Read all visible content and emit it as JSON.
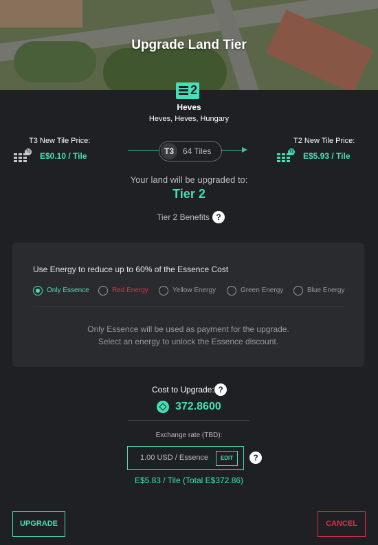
{
  "header": {
    "title": "Upgrade Land Tier"
  },
  "location": {
    "tier_badge": "2",
    "name": "Heves",
    "address": "Heves, Heves, Hungary"
  },
  "pricing": {
    "current": {
      "label": "T3 New Tile Price:",
      "value": "E$0.10 / Tile",
      "badge": "T3",
      "icon": "tile-grid-icon"
    },
    "new": {
      "label": "T2 New Tile Price:",
      "value": "E$5.93 / Tile",
      "badge": "T2",
      "icon": "tile-grid-icon"
    },
    "tiles_badge": "T3",
    "tiles_count": "64 Tiles"
  },
  "upgrade": {
    "label": "Your land will be upgraded to:",
    "tier": "Tier 2",
    "benefits_label": "Tier 2 Benefits"
  },
  "energy": {
    "heading": "Use Energy to reduce up to 60% of the Essence Cost",
    "options": [
      "Only Essence",
      "Red Energy",
      "Yellow Energy",
      "Green Energy",
      "Blue Energy"
    ],
    "selected": "Only Essence",
    "info_line1": "Only Essence will be used as payment for the upgrade.",
    "info_line2": "Select an energy to unlock the Essence discount."
  },
  "cost": {
    "label": "Cost to Upgrade:",
    "value": "372.8600",
    "exchange_label": "Exchange rate (TBD):",
    "exchange_value": "1.00 USD / Essence",
    "edit_label": "EDIT",
    "per_tile": "E$5.83 / Tile (Total E$372.86)"
  },
  "actions": {
    "upgrade_label": "UPGRADE",
    "cancel_label": "CANCEL"
  },
  "colors": {
    "accent": "#44e0b8",
    "danger": "#e0304a",
    "background": "#1f2023",
    "panel": "#2a2b2f"
  }
}
